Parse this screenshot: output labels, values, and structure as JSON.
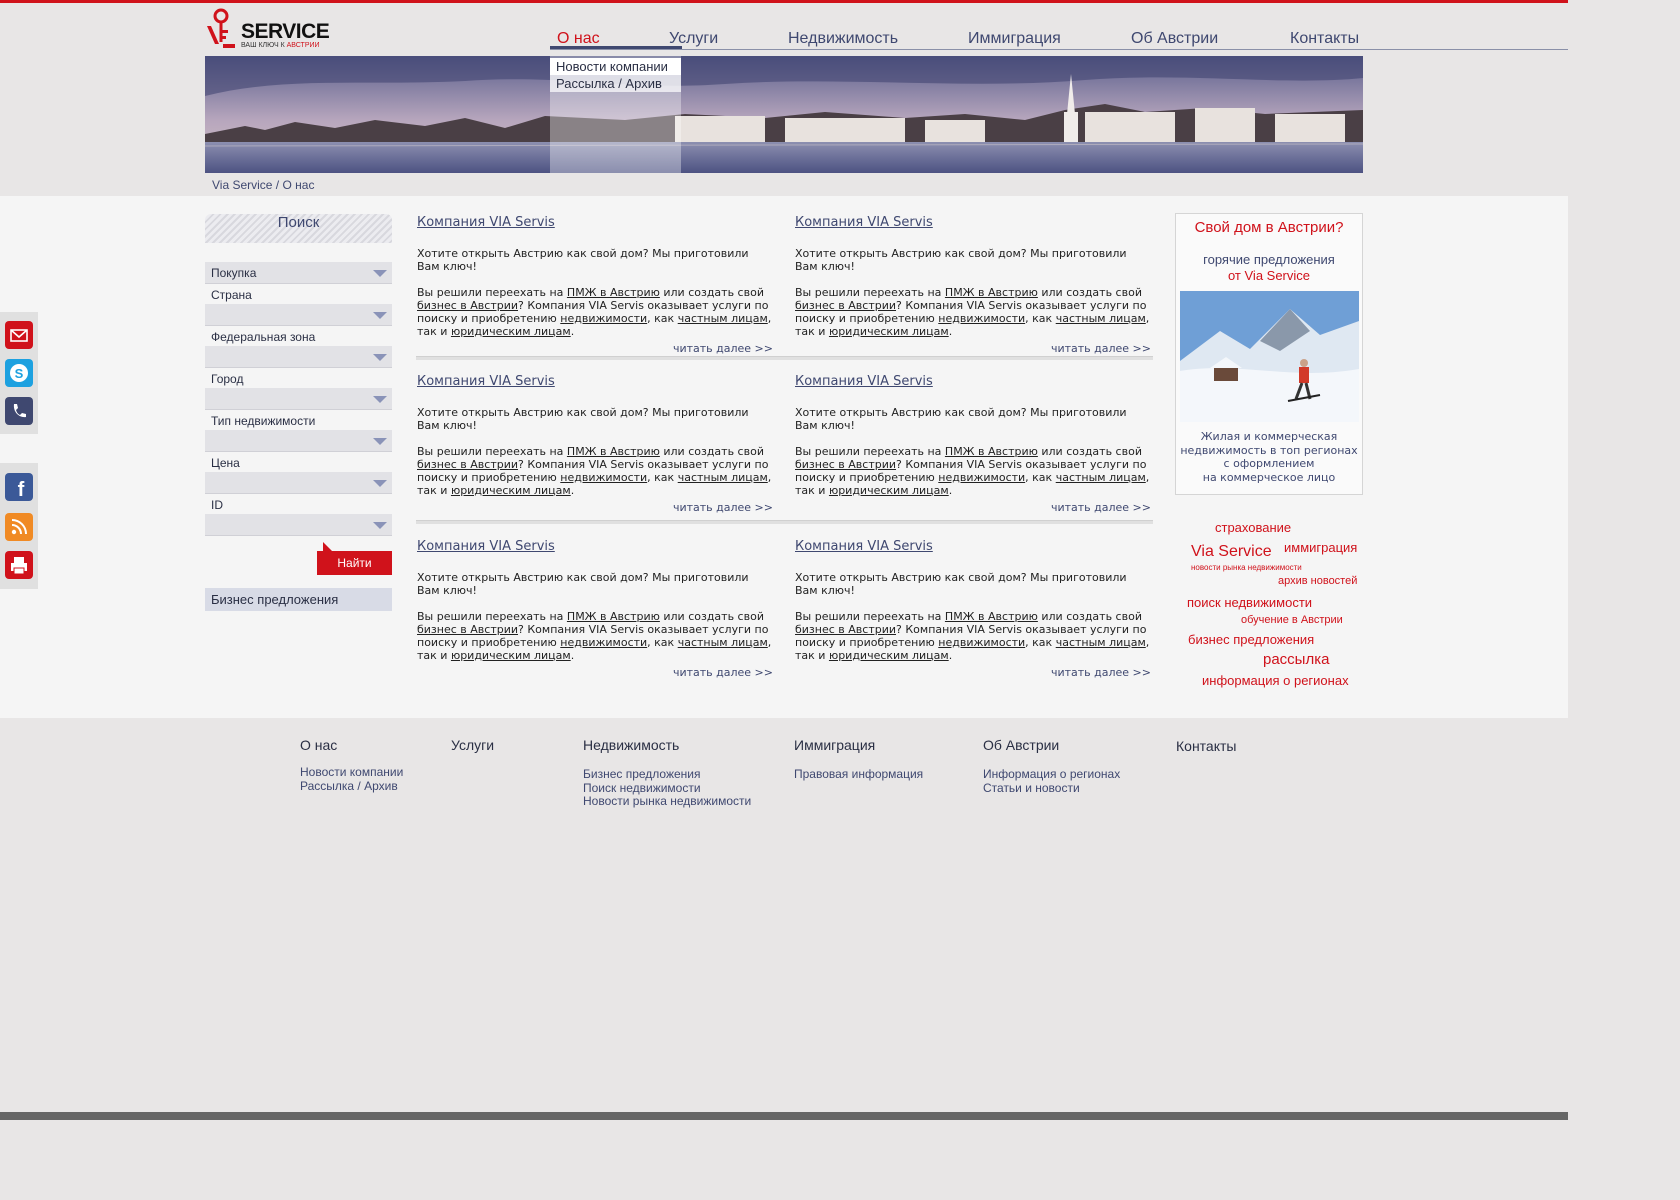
{
  "logo": {
    "word": "SERVICE",
    "tagline_prefix": "ВАШ КЛЮЧ К ",
    "tagline_accent": "АВСТРИИ"
  },
  "nav": [
    "О нас",
    "Услуги",
    "Недвижимость",
    "Иммиграция",
    "Об Австрии",
    "Контакты"
  ],
  "submenu": [
    "Новости компании",
    "Рассылка / Архив"
  ],
  "breadcrumb": "Via Service / О нас",
  "search": {
    "title": "Поиск",
    "deal_type": "Покупка",
    "fields": [
      "Страна",
      "Федеральная зона",
      "Город",
      "Тип недвижимости",
      "Цена",
      "ID"
    ],
    "button": "Найти",
    "offers_link": "Бизнес предложения"
  },
  "article": {
    "title": "Компания VIA Servis",
    "p1": "Хотите открыть Австрию как свой дом? Мы приготовили Вам ключ!",
    "p2_a": "Вы решили переехать на ",
    "link1": "ПМЖ в Австрию",
    "p2_b": " или создать свой ",
    "link2": "бизнес в Австрии",
    "p2_c": "? Компания VIA Servis оказывает услуги по поиску и приобретению ",
    "link3": "недвижимости",
    "p2_d": ", как ",
    "link4": "частным лицам",
    "p2_e": ", так и ",
    "link5": "юридическим лицам",
    "p2_f": ".",
    "more": "читать далее >>"
  },
  "promo": {
    "heading": "Свой дом в Австрии?",
    "sub1": "горячие предложения",
    "sub2": "от Via Service",
    "caption": [
      "Жилая и коммерческая",
      "недвижимость в топ регионах",
      "с оформлением",
      "на коммерческое лицо"
    ]
  },
  "tags": [
    "страхование",
    "Via Service",
    "иммиграция",
    "новости рынка недвижимости",
    "архив новостей",
    "поиск недвижимости",
    "обучение в Австрии",
    "бизнес предложения",
    "рассылка",
    "информация о регионах"
  ],
  "footer": {
    "cols": [
      {
        "title": "О нас",
        "links": [
          "Новости компании",
          "Рассылка / Архив"
        ]
      },
      {
        "title": "Услуги",
        "links": []
      },
      {
        "title": "Недвижимость",
        "links": [
          "Бизнес предложения",
          "Поиск недвижимости",
          "Новости рынка недвижимости"
        ]
      },
      {
        "title": "Иммиграция",
        "links": [
          "Правовая информация"
        ]
      },
      {
        "title": "Об Австрии",
        "links": [
          "Информация о регионах",
          "Статьи и новости"
        ]
      },
      {
        "title": "Контакты",
        "links": []
      }
    ]
  },
  "colors": {
    "accent": "#d0121b",
    "nav": "#3f4870"
  },
  "icons": [
    "mail-icon",
    "skype-icon",
    "phone-icon",
    "facebook-icon",
    "rss-icon",
    "print-icon"
  ]
}
